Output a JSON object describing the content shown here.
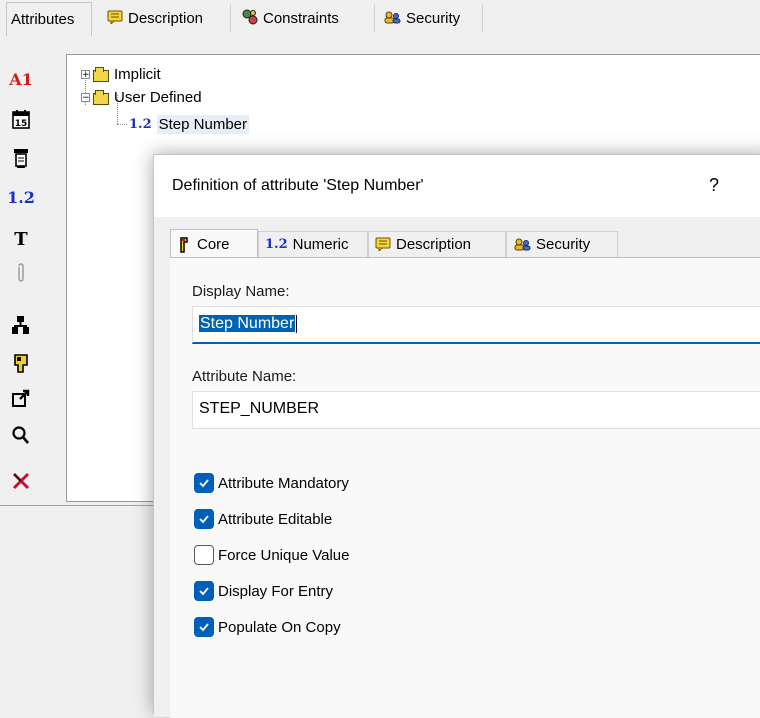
{
  "top_tabs": [
    {
      "label": "Attributes",
      "icon": "none",
      "active": true
    },
    {
      "label": "Description",
      "icon": "note-icon"
    },
    {
      "label": "Constraints",
      "icon": "constraints-icon"
    },
    {
      "label": "Security",
      "icon": "security-icon"
    }
  ],
  "toolbar": {
    "items": [
      "A1",
      "calendar-icon",
      "text-list-icon",
      "1.2",
      "T",
      "attachment-icon",
      "hierarchy-icon",
      "user-icon",
      "external-link-icon",
      "search-icon",
      "delete-icon"
    ]
  },
  "tree": {
    "implicit_label": "Implicit",
    "user_defined_label": "User Defined",
    "step_number_icon": "1.2",
    "step_number_label": "Step Number",
    "expander_collapsed": "+",
    "expander_expanded": "−"
  },
  "dialog": {
    "title": "Definition of attribute 'Step Number'",
    "help": "?",
    "tabs": [
      {
        "label": "Core",
        "icon": "core-icon",
        "active": true
      },
      {
        "label": "Numeric",
        "icon": "1.2"
      },
      {
        "label": "Description",
        "icon": "note-icon"
      },
      {
        "label": "Security",
        "icon": "security-icon"
      }
    ],
    "display_name_label": "Display Name:",
    "display_name_value": "Step Number",
    "attribute_name_label": "Attribute Name:",
    "attribute_name_value": "STEP_NUMBER",
    "checkboxes": [
      {
        "label": "Attribute Mandatory",
        "checked": true
      },
      {
        "label": "Attribute Editable",
        "checked": true
      },
      {
        "label": "Force Unique Value",
        "checked": false
      },
      {
        "label": "Display For Entry",
        "checked": true
      },
      {
        "label": "Populate On Copy",
        "checked": true
      }
    ]
  },
  "colors": {
    "accent": "#005fb8",
    "selection": "#0063b1",
    "numeric_icon": "#1a2fc8",
    "delete": "#c8102e"
  }
}
